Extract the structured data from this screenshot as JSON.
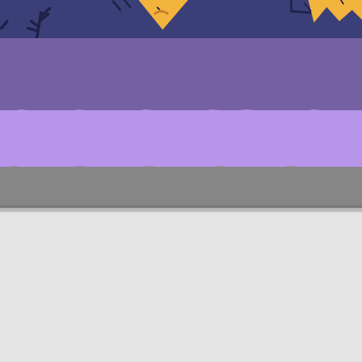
{
  "colors": {
    "navy": "#3b3f78",
    "violet": "#7561a1",
    "lavender": "#b695ea",
    "gray": "#868686",
    "pale": "#e4e4e4",
    "accent_yellow": "#f2b43c",
    "line_dark": "#1f2147"
  },
  "illustration": {
    "elements": [
      "plant-sprig",
      "yellow-triangle-creature",
      "yellow-crown-shape"
    ]
  }
}
